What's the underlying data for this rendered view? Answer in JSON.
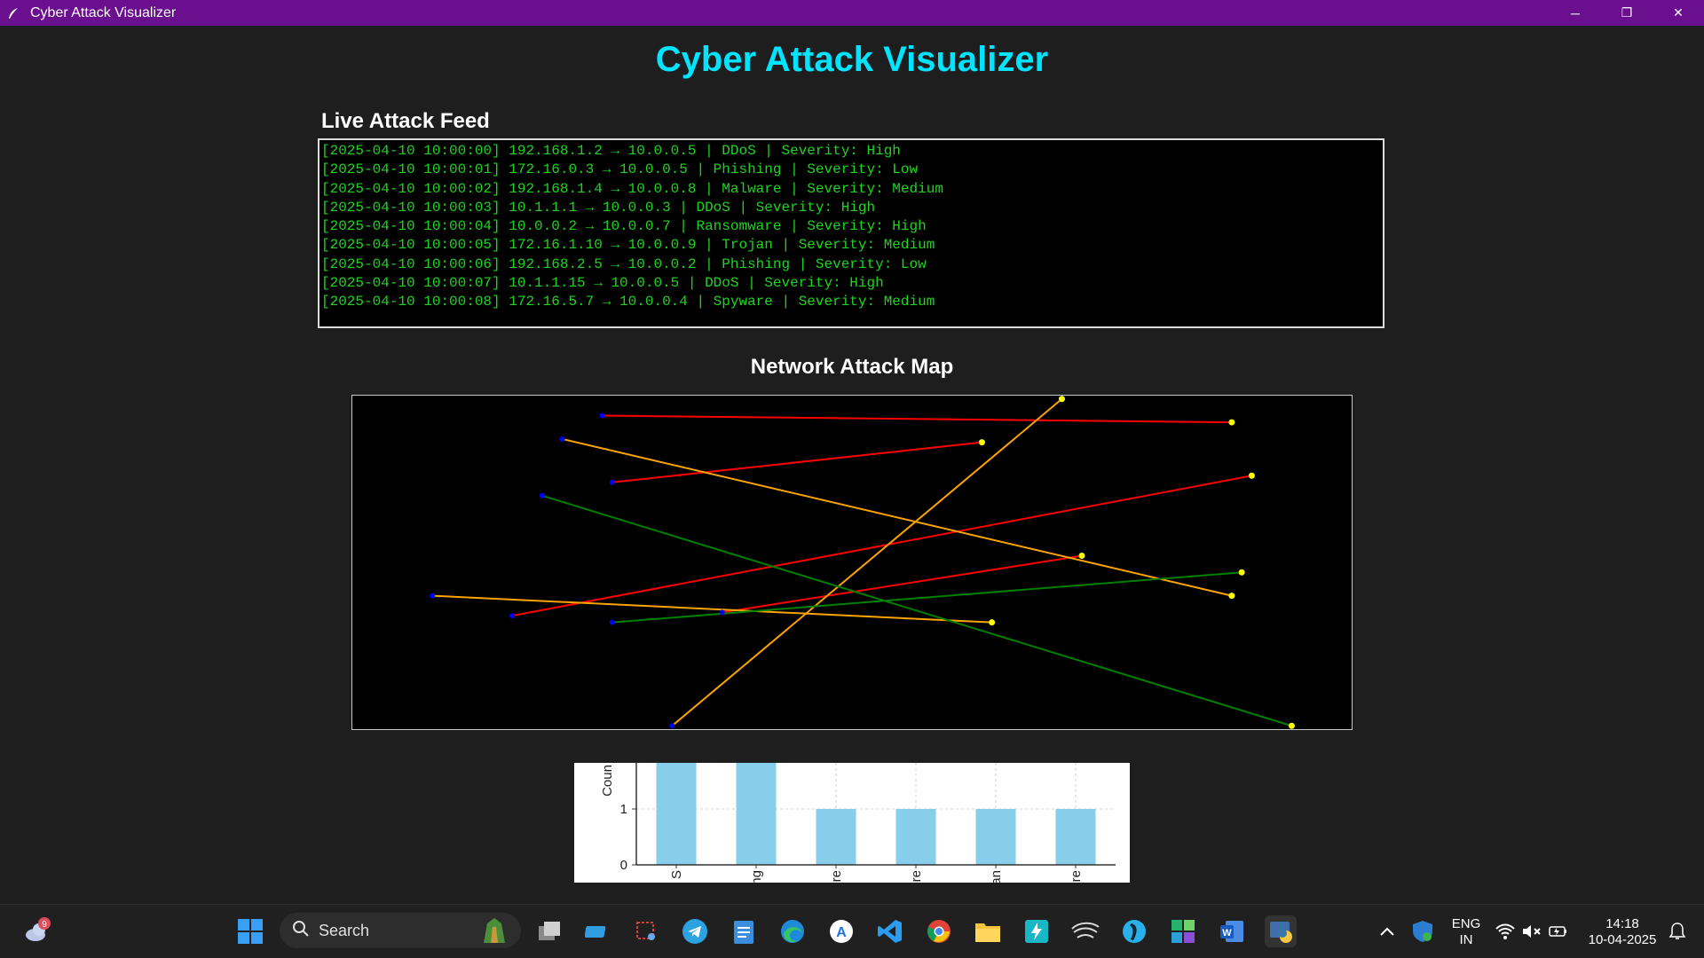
{
  "window": {
    "title": "Cyber Attack Visualizer",
    "minimize_glyph": "─",
    "restore_glyph": "❐",
    "close_glyph": "✕"
  },
  "app": {
    "title": "Cyber Attack Visualizer",
    "feed_heading": "Live Attack Feed",
    "map_heading": "Network Attack Map"
  },
  "feed": [
    "[2025-04-10 10:00:00] 192.168.1.2 → 10.0.0.5 | DDoS | Severity: High",
    "[2025-04-10 10:00:01] 172.16.0.3 → 10.0.0.5 | Phishing | Severity: Low",
    "[2025-04-10 10:00:02] 192.168.1.4 → 10.0.0.8 | Malware | Severity: Medium",
    "[2025-04-10 10:00:03] 10.1.1.1 → 10.0.0.3 | DDoS | Severity: High",
    "[2025-04-10 10:00:04] 10.0.0.2 → 10.0.0.7 | Ransomware | Severity: High",
    "[2025-04-10 10:00:05] 172.16.1.10 → 10.0.0.9 | Trojan | Severity: Medium",
    "[2025-04-10 10:00:06] 192.168.2.5 → 10.0.0.2 | Phishing | Severity: Low",
    "[2025-04-10 10:00:07] 10.1.1.15 → 10.0.0.5 | DDoS | Severity: High",
    "[2025-04-10 10:00:08] 172.16.5.7 → 10.0.0.4 | Spyware | Severity: Medium"
  ],
  "colors": {
    "title": "#00e5ff",
    "feed_text": "#1ed41e",
    "high": "#ff0000",
    "medium": "#ffa500",
    "low": "#008000",
    "source_node": "#0000ff",
    "target_node": "#ffff00",
    "bar": "#87ceeb",
    "titlebar": "#6a0f8e"
  },
  "chart_data": [
    {
      "type": "line",
      "description_role": "network attack map",
      "series": [
        {
          "severity": "High",
          "color": "#ff0000",
          "from": [
            0.25,
            0.94
          ],
          "to": [
            0.88,
            0.92
          ]
        },
        {
          "severity": "High",
          "color": "#ff0000",
          "from": [
            0.26,
            0.74
          ],
          "to": [
            0.63,
            0.86
          ]
        },
        {
          "severity": "High",
          "color": "#ff0000",
          "from": [
            0.16,
            0.34
          ],
          "to": [
            0.9,
            0.76
          ]
        },
        {
          "severity": "High",
          "color": "#ff0000",
          "from": [
            0.37,
            0.35
          ],
          "to": [
            0.73,
            0.52
          ]
        },
        {
          "severity": "Medium",
          "color": "#ffa500",
          "from": [
            0.21,
            0.87
          ],
          "to": [
            0.88,
            0.4
          ]
        },
        {
          "severity": "Medium",
          "color": "#ffa500",
          "from": [
            0.08,
            0.4
          ],
          "to": [
            0.64,
            0.32
          ]
        },
        {
          "severity": "Medium",
          "color": "#ffa500",
          "from": [
            0.32,
            0.01
          ],
          "to": [
            0.71,
            0.99
          ]
        },
        {
          "severity": "Low",
          "color": "#008000",
          "from": [
            0.19,
            0.7
          ],
          "to": [
            0.94,
            0.01
          ]
        },
        {
          "severity": "Low",
          "color": "#008000",
          "from": [
            0.26,
            0.32
          ],
          "to": [
            0.89,
            0.47
          ]
        }
      ],
      "grid": false,
      "axes": false
    },
    {
      "type": "bar",
      "categories": [
        "S",
        "ng",
        "re",
        "re",
        "an",
        "re"
      ],
      "values": [
        2,
        2,
        1,
        1,
        1,
        1
      ],
      "ylabel": "Coun",
      "y_ticks": [
        "0",
        "1"
      ],
      "ylim": [
        0,
        1.8
      ],
      "grid": true
    }
  ],
  "taskbar": {
    "weather_badge": "9",
    "search_placeholder": "Search",
    "lang_top": "ENG",
    "lang_bottom": "IN",
    "time": "14:18",
    "date": "10-04-2025"
  }
}
